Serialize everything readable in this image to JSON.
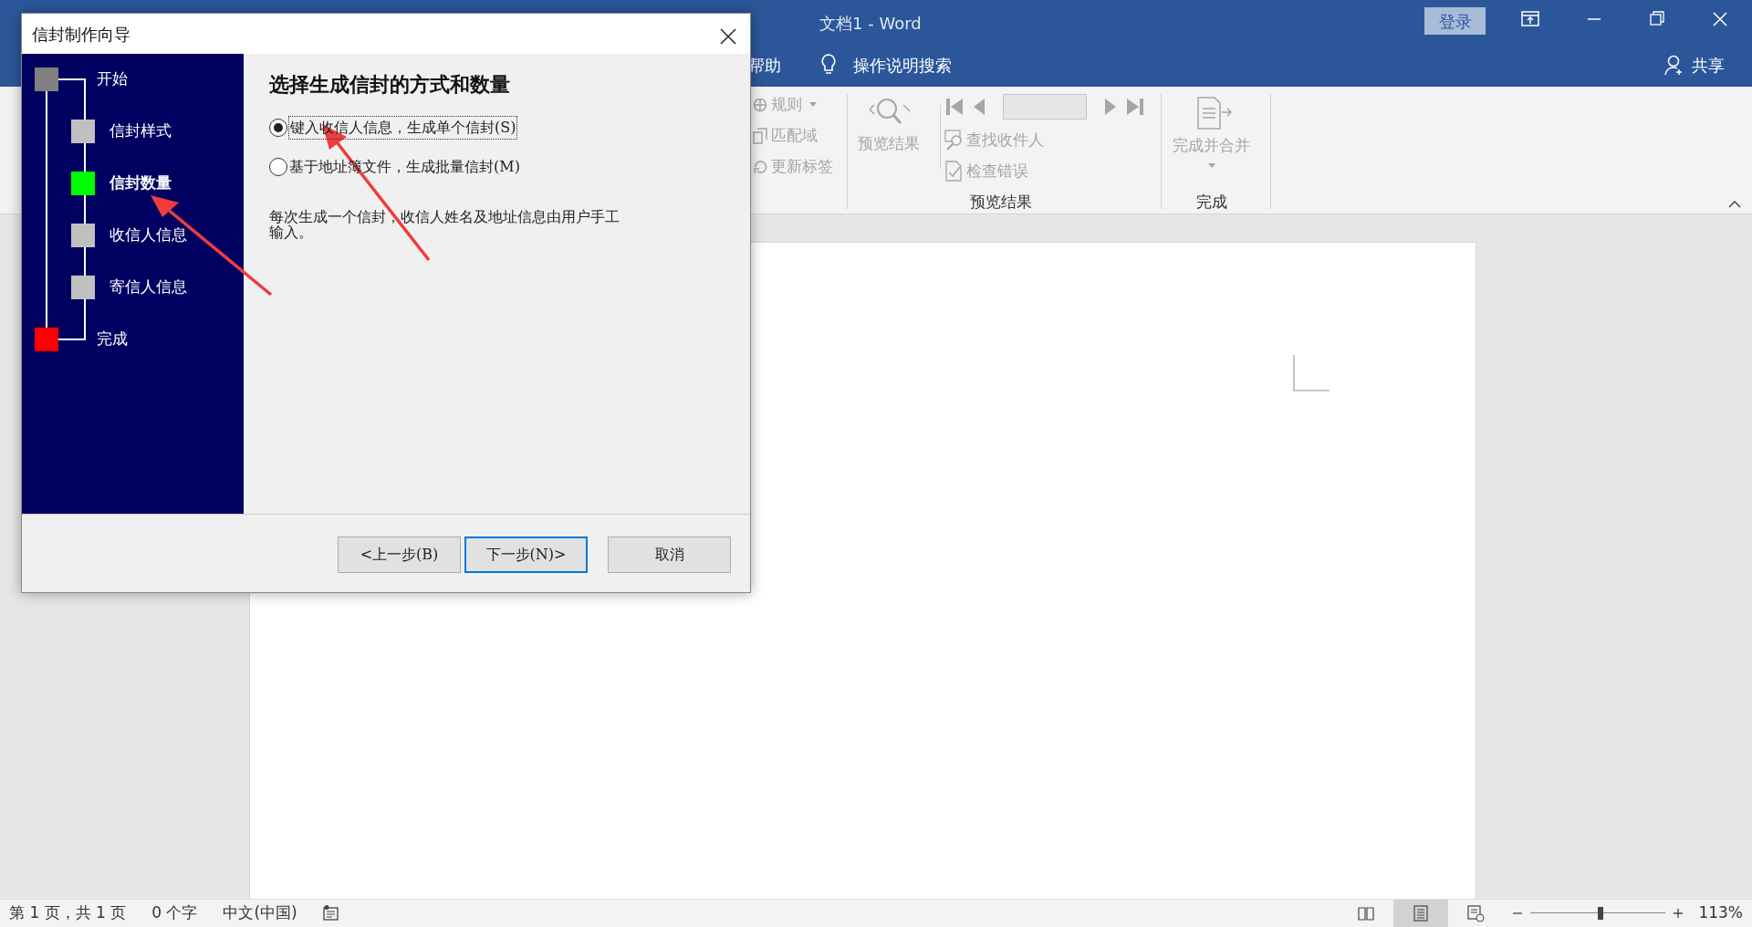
{
  "word": {
    "title": "文档1  -  Word",
    "login": "登录",
    "tab": "帮助",
    "tell_me": "操作说明搜索",
    "share": "共享"
  },
  "ribbon": {
    "small_items": [
      {
        "label": "规则",
        "dropdown": true,
        "disabled": true
      },
      {
        "label": "匹配域",
        "dropdown": false,
        "disabled": true
      },
      {
        "label": "更新标签",
        "dropdown": false,
        "disabled": true
      }
    ],
    "preview": {
      "label": "预览结果",
      "disabled": true
    },
    "nav_items": [
      {
        "label": "查找收件人",
        "disabled": true
      },
      {
        "label": "检查错误",
        "disabled": true
      }
    ],
    "preview_group": "预览结果",
    "finish": {
      "label": "完成并合并",
      "disabled": true
    },
    "finish_group": "完成"
  },
  "dialog": {
    "title": "信封制作向导",
    "steps": [
      {
        "label": "开始",
        "kind": "endpoint",
        "color": "#808080",
        "selected": false
      },
      {
        "label": "信封样式",
        "kind": "step",
        "color": "#c0c0c0",
        "selected": false
      },
      {
        "label": "信封数量",
        "kind": "step",
        "color": "#00ff00",
        "selected": true
      },
      {
        "label": "收信人信息",
        "kind": "step",
        "color": "#c0c0c0",
        "selected": false
      },
      {
        "label": "寄信人信息",
        "kind": "step",
        "color": "#c0c0c0",
        "selected": false
      },
      {
        "label": "完成",
        "kind": "endpoint",
        "color": "#ff0000",
        "selected": false
      }
    ],
    "heading": "选择生成信封的方式和数量",
    "options": [
      {
        "label": "键入收信人信息，生成单个信封(S)",
        "selected": true,
        "focused": true
      },
      {
        "label": "基于地址簿文件，生成批量信封(M)",
        "selected": false,
        "focused": false
      }
    ],
    "description": "每次生成一个信封，收信人姓名及地址信息由用户手工输入。",
    "buttons": [
      {
        "label": "<上一步(B)",
        "default": false
      },
      {
        "label": "下一步(N)>",
        "default": true
      },
      {
        "label": "取消",
        "default": false
      }
    ]
  },
  "status_bar": {
    "items": [
      "第 1 页，共 1 页",
      "0 个字",
      "中文(中国)"
    ],
    "views": [
      {
        "selected": false
      },
      {
        "selected": true
      },
      {
        "selected": false
      }
    ],
    "zoom": {
      "level": 0.52,
      "label": "113%"
    }
  }
}
